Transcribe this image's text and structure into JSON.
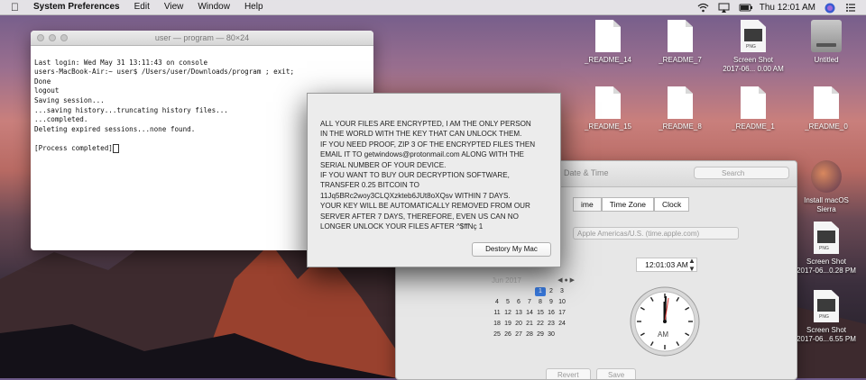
{
  "menubar": {
    "app_name": "System Preferences",
    "menus": [
      "Edit",
      "View",
      "Window",
      "Help"
    ],
    "clock": "Thu 12:01 AM"
  },
  "terminal": {
    "title": "user — program — 80×24",
    "lines": [
      "Last login: Wed May 31 13:11:43 on console",
      "users-MacBook-Air:~ user$ /Users/user/Downloads/program ; exit;",
      "Done",
      "logout",
      "Saving session...",
      "...saving history...truncating history files...",
      "...completed.",
      "Deleting expired sessions...none found.",
      "",
      "[Process completed]"
    ]
  },
  "ransom": {
    "message": "ALL YOUR FILES ARE ENCRYPTED, I AM THE ONLY PERSON\nIN THE WORLD WITH THE KEY THAT CAN UNLOCK THEM.\nIF YOU NEED PROOF, ZIP 3 OF THE ENCRYPTED FILES THEN\nEMAIL IT TO getwindows@protonmail.com ALONG WITH THE\nSERIAL NUMBER OF YOUR DEVICE.\nIF YOU WANT TO BUY OUR DECRYPTION SOFTWARE,\nTRANSFER 0.25 BITCOIN TO\n11Jq5BRc2woy3CLQXzkteb6JUt8oXQsv WITHIN 7 DAYS.\nYOUR KEY WILL BE AUTOMATICALLY REMOVED FROM OUR\nSERVER AFTER 7 DAYS, THEREFORE, EVEN US CAN NO\nLONGER UNLOCK YOUR FILES AFTER ^$ffNç 1",
    "button_label": "Destory My Mac"
  },
  "prefs": {
    "title": "Date & Time",
    "search_placeholder": "Search",
    "tabs": [
      "ime",
      "Time Zone",
      "Clock"
    ],
    "server": "Apple Americas/U.S. (time.apple.com)",
    "time": "12:01:03 AM",
    "calendar": {
      "month": "Jun 2017",
      "days": [
        "",
        "",
        "",
        "",
        "1",
        "2",
        "3",
        "4",
        "5",
        "6",
        "7",
        "8",
        "9",
        "10",
        "11",
        "12",
        "13",
        "14",
        "15",
        "16",
        "17",
        "18",
        "19",
        "20",
        "21",
        "22",
        "23",
        "24",
        "25",
        "26",
        "27",
        "28",
        "29",
        "30",
        ""
      ],
      "selected": "1"
    },
    "clock_label": "AM",
    "revert_label": "Revert",
    "save_label": "Save"
  },
  "desktop": {
    "icons": [
      {
        "label": "_README_14",
        "kind": "doc"
      },
      {
        "label": "_README_7",
        "kind": "doc"
      },
      {
        "label": "Screen Shot\n2017-06... 0.00 AM",
        "kind": "png"
      },
      {
        "label": "Untitled",
        "kind": "disk"
      },
      {
        "label": "_README_15",
        "kind": "doc"
      },
      {
        "label": "_README_8",
        "kind": "doc"
      },
      {
        "label": "_README_1",
        "kind": "doc"
      },
      {
        "label": "_README_0",
        "kind": "doc"
      },
      {
        "label": "Install macOS\nSierra",
        "kind": "installer"
      },
      {
        "label": "Screen Shot\n2017-06...0.28 PM",
        "kind": "png"
      },
      {
        "label": "Screen Shot\n2017-06...6.55 PM",
        "kind": "png"
      }
    ]
  }
}
